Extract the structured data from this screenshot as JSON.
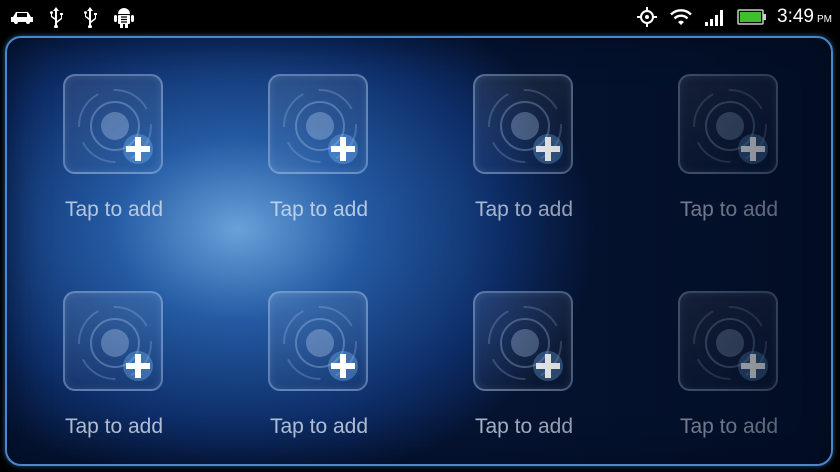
{
  "status_bar": {
    "left_icons": [
      "car-icon",
      "usb-icon",
      "usb-icon",
      "android-debug-icon"
    ],
    "right_icons": [
      "gps-icon",
      "wifi-icon",
      "signal-icon",
      "battery-icon"
    ],
    "time": "3:49",
    "ampm": "PM",
    "battery_color": "#3fbf2b"
  },
  "grid": {
    "rows": 2,
    "columns": 4,
    "slots": [
      {
        "label": "Tap to add"
      },
      {
        "label": "Tap to add"
      },
      {
        "label": "Tap to add"
      },
      {
        "label": "Tap to add"
      },
      {
        "label": "Tap to add"
      },
      {
        "label": "Tap to add"
      },
      {
        "label": "Tap to add"
      },
      {
        "label": "Tap to add"
      }
    ]
  },
  "colors": {
    "panel_glow": "#6eaae6",
    "panel_dark": "#0e306e",
    "panel_border": "#4b86c8"
  }
}
